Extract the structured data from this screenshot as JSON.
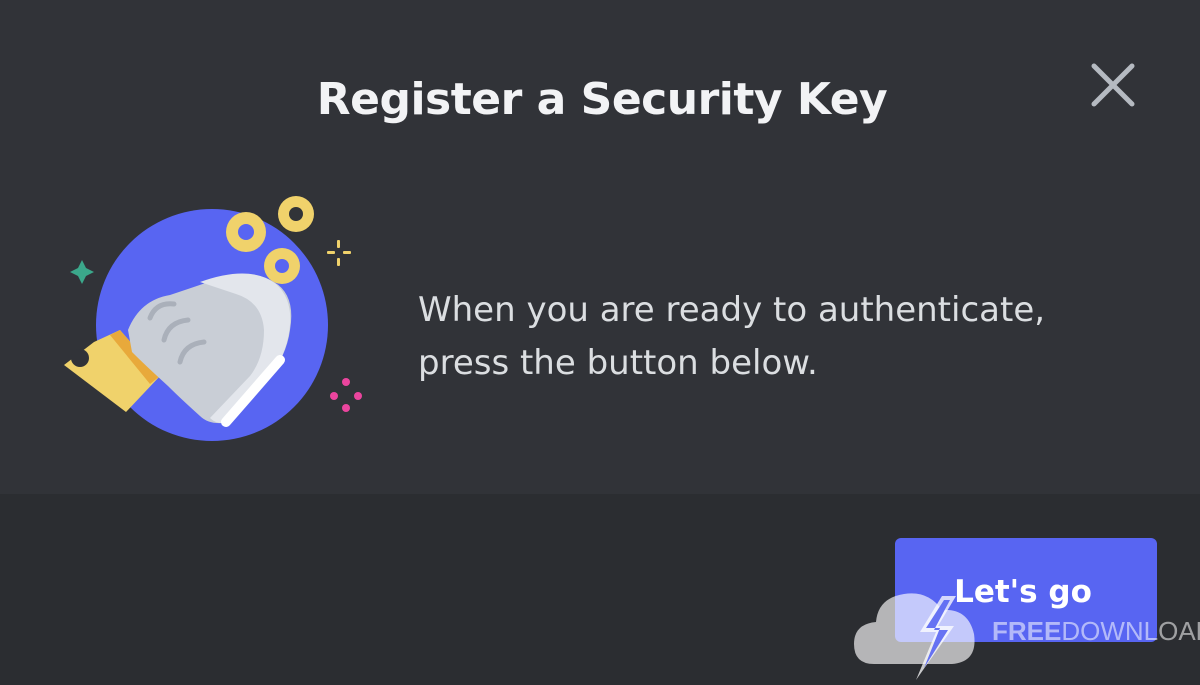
{
  "modal": {
    "title": "Register a Security Key",
    "description_line1": "When you are ready to authenticate,",
    "description_line2": "press the button below.",
    "close_icon": "close-icon",
    "illustration_icon": "security-key-hand-illustration"
  },
  "footer": {
    "primary_button_label": "Let's go"
  },
  "watermark": {
    "brand_strong": "FREE",
    "brand_light": "DOWNLOAD",
    "icon": "cloud-lightning-icon"
  },
  "colors": {
    "background": "#313338",
    "footer_background": "#2b2d31",
    "accent": "#5865f2",
    "title_text": "#f2f3f5",
    "body_text": "#dbdee1",
    "key_yellow": "#f0d26b",
    "circle_blue": "#5865f2"
  }
}
